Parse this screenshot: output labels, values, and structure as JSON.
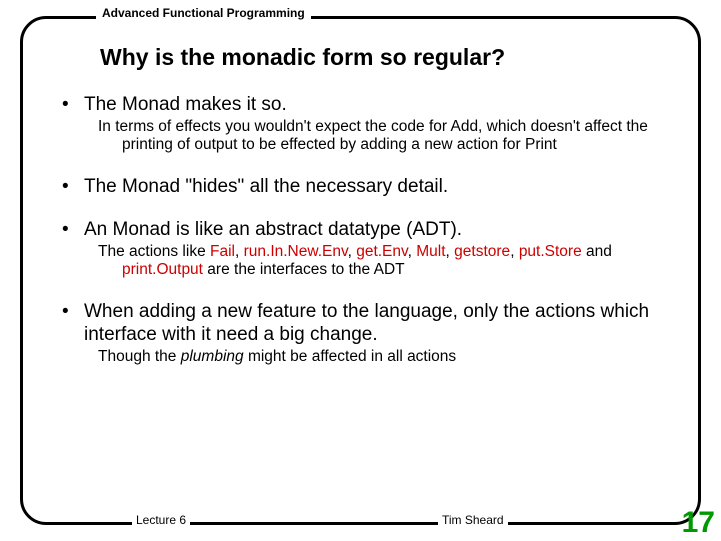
{
  "header": "Advanced Functional Programming",
  "title": "Why is the monadic form so regular?",
  "bullets": [
    {
      "main": "The Monad makes it so.",
      "sub_plain": "In terms of effects you wouldn't expect the code for Add, which doesn't affect the printing of output to be effected by adding a new action for Print"
    },
    {
      "main": "The Monad  \"hides\" all the necessary detail."
    },
    {
      "main": "An Monad is like an abstract datatype (ADT).",
      "sub_rich": {
        "prefix": "The actions like ",
        "kw": [
          "Fail",
          "run.In.New.Env",
          "get.Env",
          "Mult",
          "getstore",
          "put.Store"
        ],
        "sep": ", ",
        "lastsep": " and ",
        "final_kw": "print.Output",
        "suffix": " are the interfaces to the ADT"
      }
    },
    {
      "main": "When adding a new feature to the language, only the actions which interface with it need a big change.",
      "sub_em": {
        "before": "Though the ",
        "em": "plumbing",
        "after": " might be affected in all actions"
      }
    }
  ],
  "footer": {
    "left": "Lecture 6",
    "center": "Tim Sheard",
    "page": "17"
  }
}
